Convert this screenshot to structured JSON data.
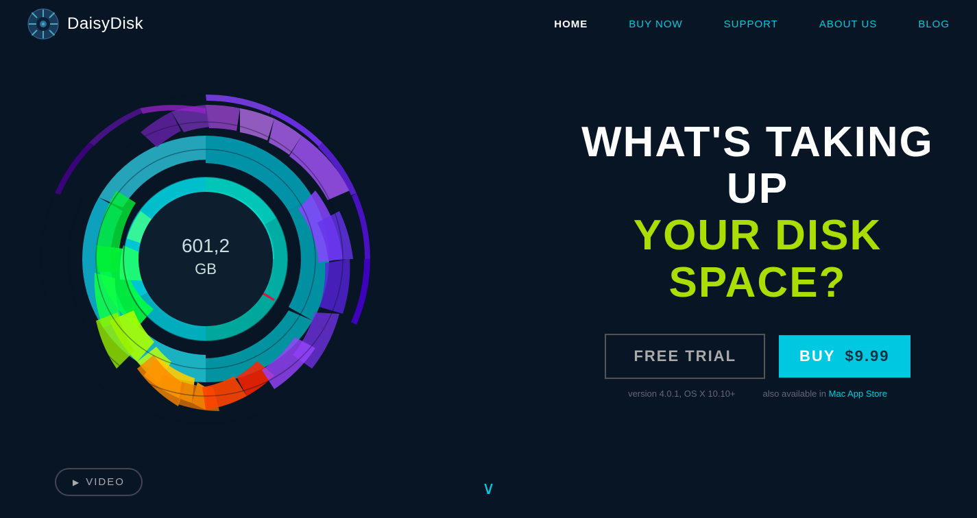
{
  "logo": {
    "text": "DaisyDisk"
  },
  "nav": {
    "links": [
      {
        "label": "HOME",
        "active": true
      },
      {
        "label": "BUY NOW",
        "active": false
      },
      {
        "label": "SUPPORT",
        "active": false
      },
      {
        "label": "ABOUT US",
        "active": false
      },
      {
        "label": "BLOG",
        "active": false
      }
    ]
  },
  "hero": {
    "headline_white": "WHAT'S TAKING UP",
    "headline_green": "YOUR DISK SPACE?",
    "disk_label": "601,2",
    "disk_unit": "GB",
    "cta_trial": "FREE TRIAL",
    "cta_buy": "BUY",
    "cta_price": "$9.99",
    "version_text": "version 4.0.1, OS X 10.10+",
    "store_text": "also available in ",
    "store_link": "Mac App Store"
  },
  "video": {
    "label": "VIDEO"
  }
}
